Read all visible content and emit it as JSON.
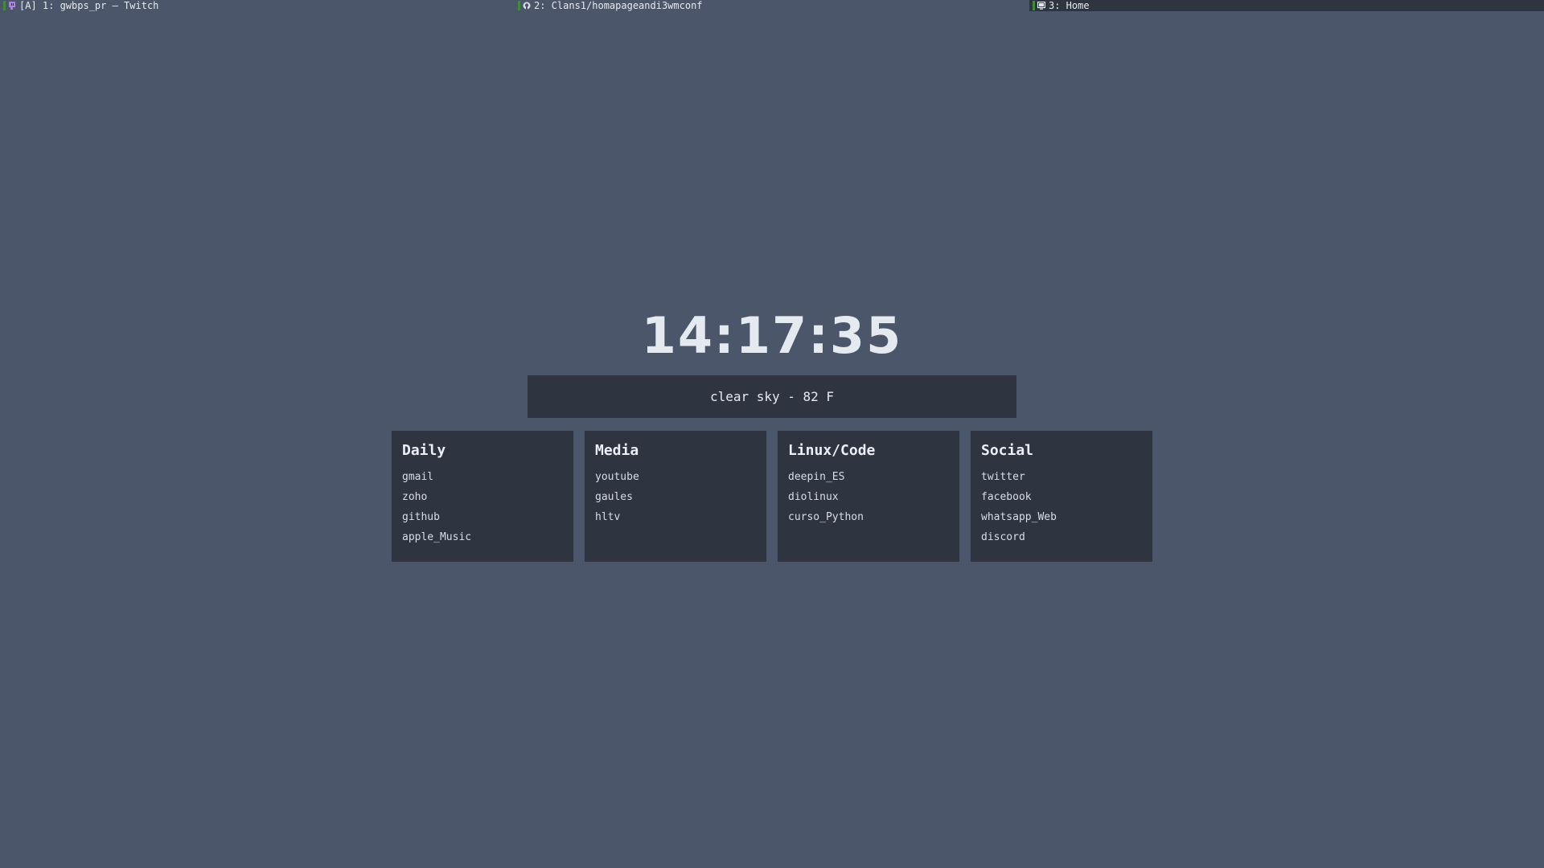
{
  "tabs": [
    {
      "label": "[A] 1: gwbps_pr – Twitch",
      "icon": "twitch-icon",
      "active": false
    },
    {
      "label": "2: Clans1/homapageandi3wmconf",
      "icon": "github-icon",
      "active": false
    },
    {
      "label": "3: Home",
      "icon": "monitor-icon",
      "active": true
    }
  ],
  "clock": {
    "time": "14:17:35"
  },
  "weather": {
    "text": "clear sky - 82 F"
  },
  "cards": [
    {
      "title": "Daily",
      "links": [
        "gmail",
        "zoho",
        "github",
        "apple_Music"
      ]
    },
    {
      "title": "Media",
      "links": [
        "youtube",
        "gaules",
        "hltv"
      ]
    },
    {
      "title": "Linux/Code",
      "links": [
        "deepin_ES",
        "diolinux",
        "curso_Python"
      ]
    },
    {
      "title": "Social",
      "links": [
        "twitter",
        "facebook",
        "whatsapp_Web",
        "discord"
      ]
    }
  ],
  "colors": {
    "background": "#4c566a",
    "panel": "#2e3440",
    "text": "#e5e9f0",
    "tab_indicator": "#3c8c3c"
  }
}
